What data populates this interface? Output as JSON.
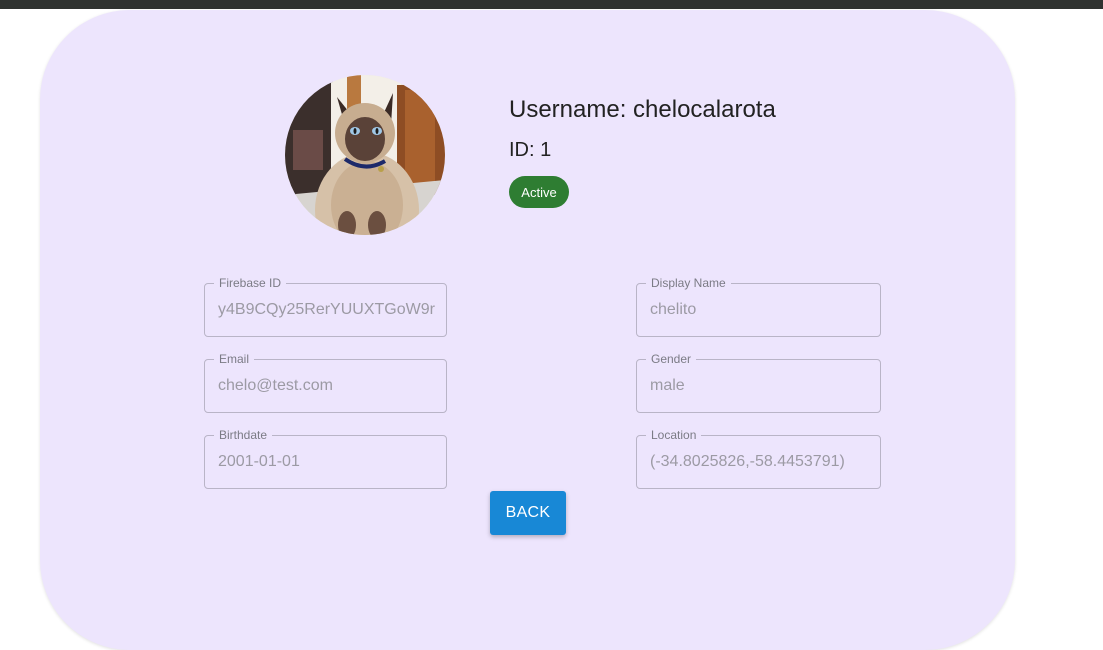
{
  "profile": {
    "avatar_alt": "Siamese cat profile picture",
    "username_text": "Username: chelocalarota",
    "id_text": "ID: 1",
    "status_label": "Active",
    "status_color": "#2e7d32"
  },
  "fields": {
    "firebase_id": {
      "label": "Firebase ID",
      "value": "y4B9CQy25RerYUUXTGoW9r"
    },
    "display_name": {
      "label": "Display Name",
      "value": "chelito"
    },
    "email": {
      "label": "Email",
      "value": "chelo@test.com"
    },
    "gender": {
      "label": "Gender",
      "value": "male"
    },
    "birthdate": {
      "label": "Birthdate",
      "value": "2001-01-01"
    },
    "location": {
      "label": "Location",
      "value": "(-34.8025826,-58.4453791)"
    }
  },
  "actions": {
    "back_label": "BACK",
    "back_color": "#1888d6"
  },
  "theme": {
    "card_background": "#ede5fd"
  }
}
